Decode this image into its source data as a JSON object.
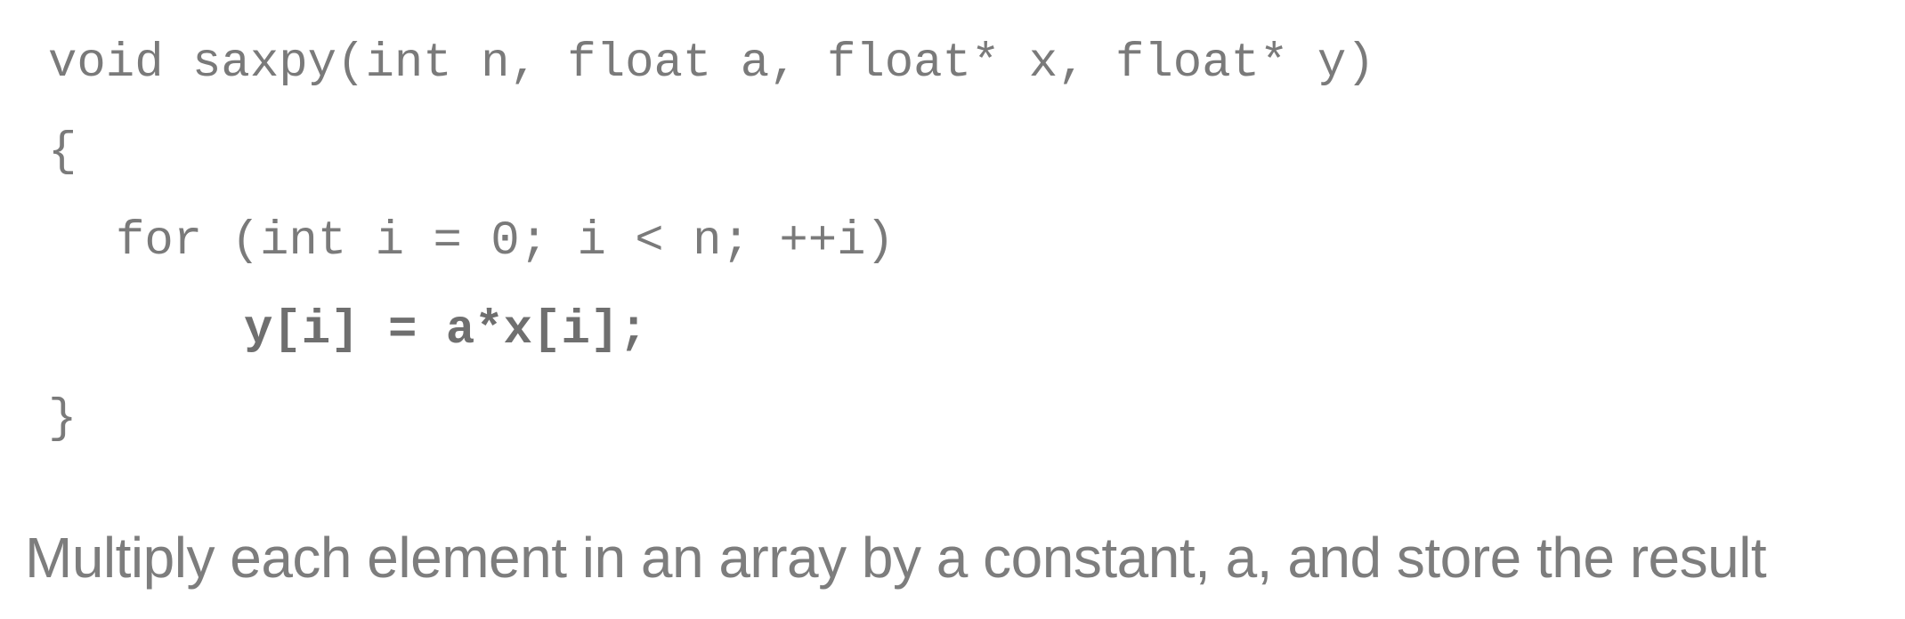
{
  "code": {
    "line1": "void saxpy(int n, float a, float* x, float* y)",
    "line2": "{",
    "line3": "for (int i = 0; i < n; ++i)",
    "line4": "y[i] = a*x[i];",
    "line5": "}"
  },
  "caption": "Multiply each element in an array by a constant, a, and store the result"
}
